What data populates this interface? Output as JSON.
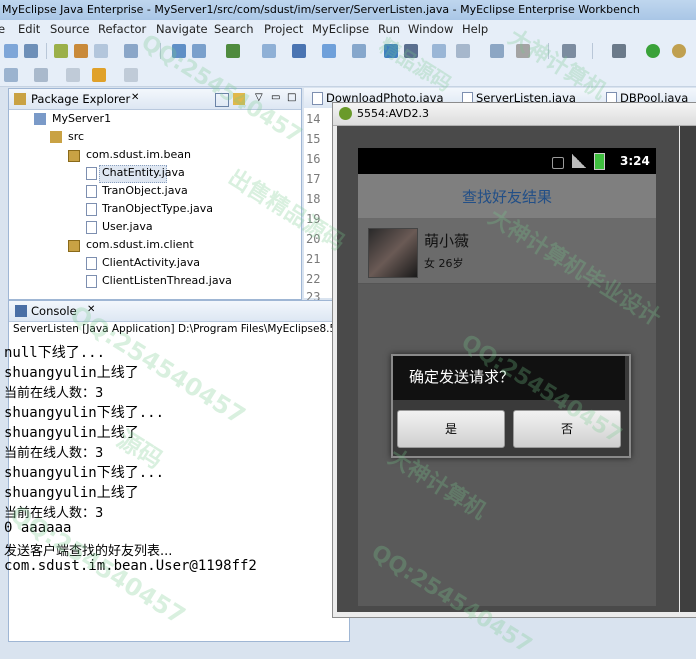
{
  "window": {
    "title": "MyEclipse Java Enterprise - MyServer1/src/com/sdust/im/server/ServerListen.java - MyEclipse Enterprise Workbench"
  },
  "menu": [
    "e",
    "Edit",
    "Source",
    "Refactor",
    "Navigate",
    "Search",
    "Project",
    "MyEclipse",
    "Run",
    "Window",
    "Help"
  ],
  "package_explorer": {
    "tab_label": "Package Explorer",
    "tree": [
      {
        "label": "MyServer1",
        "kind": "project",
        "indent": 0
      },
      {
        "label": "src",
        "kind": "folder",
        "indent": 1
      },
      {
        "label": "com.sdust.im.bean",
        "kind": "package",
        "indent": 2
      },
      {
        "label": "ChatEntity.java",
        "kind": "file",
        "indent": 3,
        "selected": true
      },
      {
        "label": "TranObject.java",
        "kind": "file",
        "indent": 3
      },
      {
        "label": "TranObjectType.java",
        "kind": "file",
        "indent": 3
      },
      {
        "label": "User.java",
        "kind": "file",
        "indent": 3
      },
      {
        "label": "com.sdust.im.client",
        "kind": "package",
        "indent": 2
      },
      {
        "label": "ClientActivity.java",
        "kind": "file",
        "indent": 3
      },
      {
        "label": "ClientListenThread.java",
        "kind": "file",
        "indent": 3
      }
    ]
  },
  "editor": {
    "tabs": [
      "DownloadPhoto.java",
      "ServerListen.java",
      "DBPool.java"
    ],
    "line_numbers": [
      "14",
      "15",
      "16",
      "17",
      "18",
      "19",
      "20",
      "21",
      "22",
      "23"
    ]
  },
  "console": {
    "tab_label": "Console",
    "subtitle": "ServerListen [Java Application] D:\\Program Files\\MyEclipse8.5",
    "lines": [
      "null下线了...",
      "shuangyulin上线了",
      "当前在线人数：3",
      "shuangyulin下线了...",
      "shuangyulin上线了",
      "当前在线人数：3",
      "shuangyulin下线了...",
      "shuangyulin上线了",
      "当前在线人数：3",
      "0 aaaaaa",
      "发送客户端查找的好友列表...",
      "com.sdust.im.bean.User@1198ff2"
    ]
  },
  "emulator": {
    "window_title": "5554:AVD2.3",
    "status_time": "3:24",
    "app_title": "查找好友结果",
    "result": {
      "name": "萌小薇",
      "info": "女  26岁"
    },
    "dialog": {
      "title": "确定发送请求？",
      "yes": "是",
      "no": "否"
    }
  },
  "watermark": [
    "QQ:254540457",
    "精品源码",
    "大神计算机",
    "源码",
    "出售精品源码",
    "大神计算机毕业设计"
  ],
  "colors": {
    "accent": "#224f87",
    "title_bar": "#bfd6ee",
    "panel_header": "#dde7f3"
  }
}
